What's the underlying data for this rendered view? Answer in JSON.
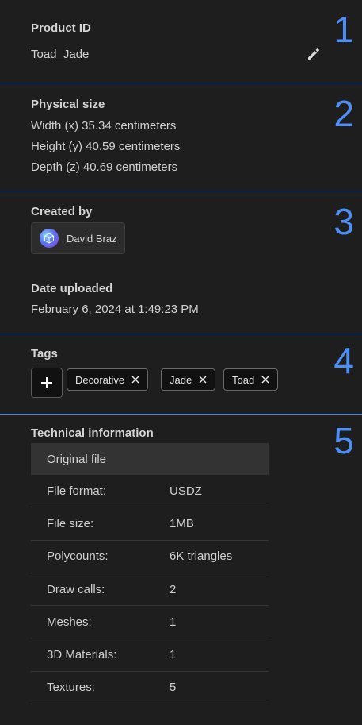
{
  "sections": {
    "product": {
      "step": "1",
      "heading": "Product ID",
      "value": "Toad_Jade"
    },
    "physical": {
      "step": "2",
      "heading": "Physical size",
      "width": "Width (x) 35.34 centimeters",
      "height": "Height (y) 40.59 centimeters",
      "depth": "Depth (z) 40.69 centimeters"
    },
    "creator": {
      "step": "3",
      "heading": "Created by",
      "user_name": "David Braz",
      "date_heading": "Date uploaded",
      "date_value": "February 6, 2024 at 1:49:23 PM"
    },
    "tags": {
      "step": "4",
      "heading": "Tags",
      "items": [
        "Decorative",
        "Jade",
        "Toad"
      ]
    },
    "technical": {
      "step": "5",
      "heading": "Technical information",
      "table_header": "Original file",
      "rows": [
        {
          "key": "File format:",
          "value": "USDZ"
        },
        {
          "key": "File size:",
          "value": "1MB"
        },
        {
          "key": "Polycounts:",
          "value": "6K triangles"
        },
        {
          "key": "Draw calls:",
          "value": "2"
        },
        {
          "key": "Meshes:",
          "value": "1"
        },
        {
          "key": "3D Materials:",
          "value": "1"
        },
        {
          "key": "Textures:",
          "value": "5"
        }
      ]
    }
  },
  "colors": {
    "background": "#1e1e1e",
    "divider": "#4a7ee8",
    "step_number": "#4f8ff5"
  },
  "icons": {
    "edit": "pencil-icon",
    "add": "plus-icon",
    "remove": "close-icon",
    "avatar": "user-avatar"
  }
}
